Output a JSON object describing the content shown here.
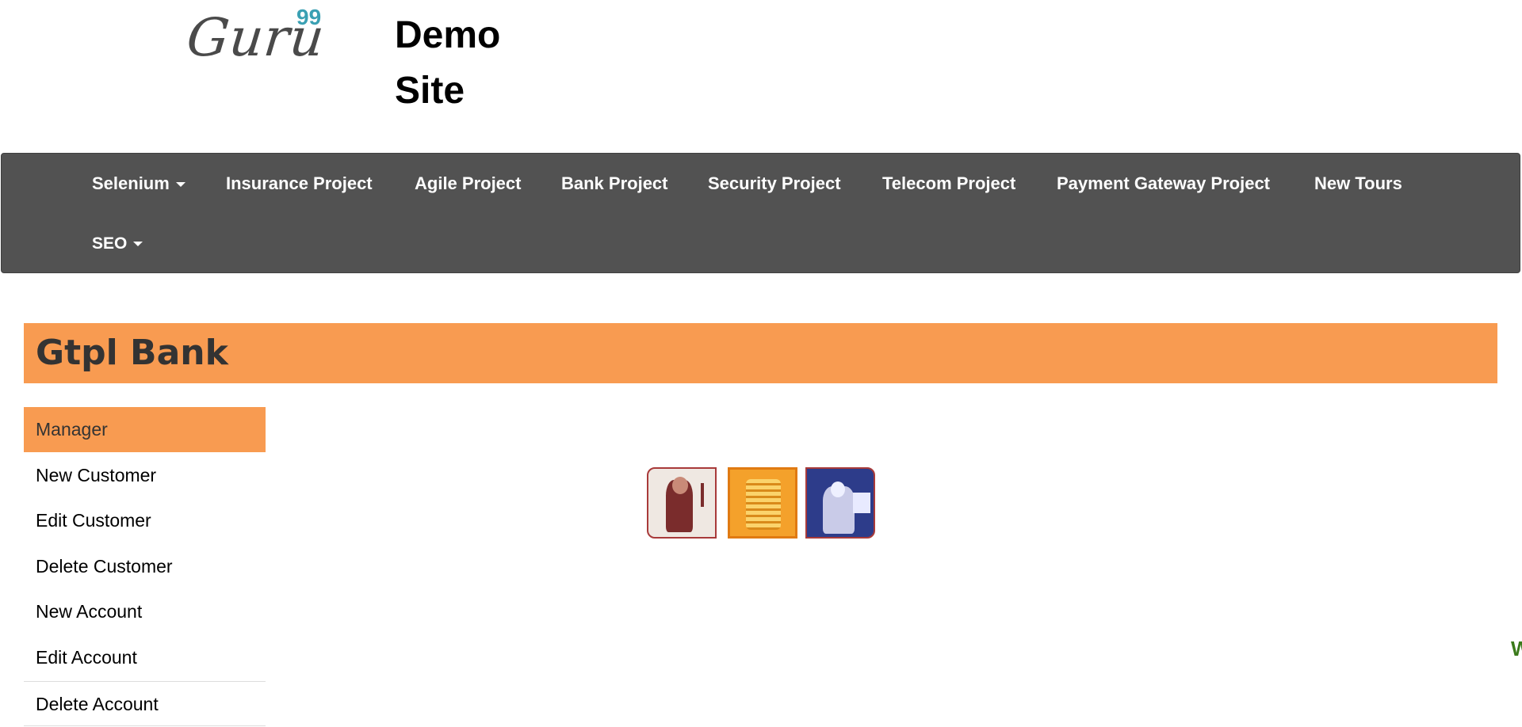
{
  "header": {
    "logo_text": "Guru",
    "logo_sup": "99",
    "site_title_line1": "Demo",
    "site_title_line2": "Site"
  },
  "nav": {
    "items": [
      {
        "label": "Selenium",
        "dropdown": true
      },
      {
        "label": "Insurance Project",
        "dropdown": false
      },
      {
        "label": "Agile Project",
        "dropdown": false
      },
      {
        "label": "Bank Project",
        "dropdown": false
      },
      {
        "label": "Security Project",
        "dropdown": false
      },
      {
        "label": "Telecom Project",
        "dropdown": false
      },
      {
        "label": "Payment Gateway Project",
        "dropdown": false
      },
      {
        "label": "New Tours",
        "dropdown": false
      },
      {
        "label": "SEO",
        "dropdown": true
      }
    ]
  },
  "bank": {
    "title": "Gtpl Bank"
  },
  "sidebar": {
    "items": [
      {
        "label": "Manager"
      },
      {
        "label": "New Customer"
      },
      {
        "label": "Edit Customer"
      },
      {
        "label": "Delete Customer"
      },
      {
        "label": "New Account"
      },
      {
        "label": "Edit Account"
      },
      {
        "label": "Delete Account"
      }
    ]
  },
  "edge_text": "W",
  "colors": {
    "accent": "#f89b51",
    "nav_bg": "#525252",
    "logo_sup": "#3aa0b3"
  }
}
